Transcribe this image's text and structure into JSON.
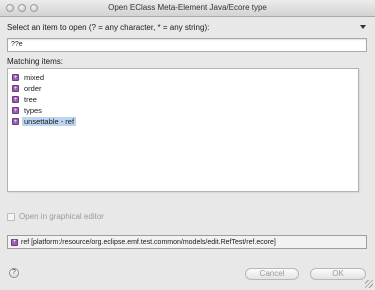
{
  "window": {
    "title": "Open EClass Meta-Element Java/Ecore type"
  },
  "prompt": {
    "label": "Select an item to open (? = any character, * = any string):"
  },
  "filter": {
    "value": "??e"
  },
  "matching": {
    "label": "Matching items:",
    "items": [
      {
        "label": "mixed",
        "selected": false
      },
      {
        "label": "order",
        "selected": false
      },
      {
        "label": "tree",
        "selected": false
      },
      {
        "label": "types",
        "selected": false
      },
      {
        "label": "unsettable - ref",
        "selected": true
      }
    ]
  },
  "options": {
    "graphical_editor_label": "Open in graphical editor",
    "graphical_editor_checked": false
  },
  "detail": {
    "text": "ref [platform:/resource/org.eclipse.emf.test.common/models/edit.RefTest/ref.ecore]"
  },
  "buttons": {
    "cancel_label": "Cancel",
    "ok_label": "OK",
    "help_label": "?"
  },
  "colors": {
    "selection": "#bcd6f2",
    "class_icon": "#9a5fb0"
  }
}
